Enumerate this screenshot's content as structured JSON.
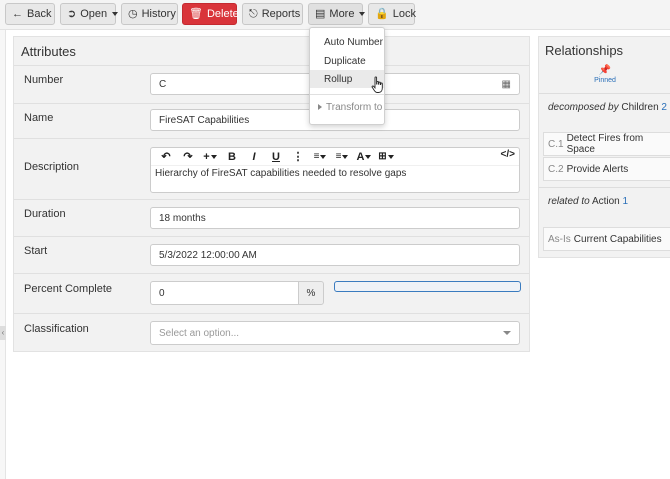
{
  "toolbar": {
    "back": "Back",
    "open": "Open",
    "history": "History",
    "delete": "Delete",
    "reports": "Reports",
    "more": "More",
    "lock": "Lock"
  },
  "more_menu": {
    "items": [
      "Auto Number",
      "Duplicate",
      "Rollup"
    ],
    "submenu": "Transform to"
  },
  "attributes": {
    "title": "Attributes",
    "number_label": "Number",
    "number_value": "C",
    "name_label": "Name",
    "name_value": "FireSAT Capabilities",
    "description_label": "Description",
    "description_value": "Hierarchy of FireSAT capabilities needed to resolve gaps",
    "duration_label": "Duration",
    "duration_value": "18 months",
    "start_label": "Start",
    "start_value": "5/3/2022 12:00:00 AM",
    "percent_label": "Percent Complete",
    "percent_value": "0",
    "percent_suffix": "%",
    "progress_fraction": 0,
    "classification_label": "Classification",
    "classification_placeholder": "Select an option..."
  },
  "relationships": {
    "title": "Relationships",
    "pinned": "Pinned",
    "groups": [
      {
        "verb": "decomposed by",
        "target": "Children",
        "count": "2"
      },
      {
        "verb": "related to",
        "target": "Action",
        "count": "1"
      }
    ],
    "children": [
      {
        "code": "C.1",
        "name": "Detect Fires from Space"
      },
      {
        "code": "C.2",
        "name": "Provide Alerts"
      }
    ],
    "current": {
      "code": "As-Is",
      "name": "Current Capabilities"
    }
  },
  "colors": {
    "delete": "#d9343a",
    "link": "#2a6fb8",
    "progress": "#3a7bbf"
  }
}
